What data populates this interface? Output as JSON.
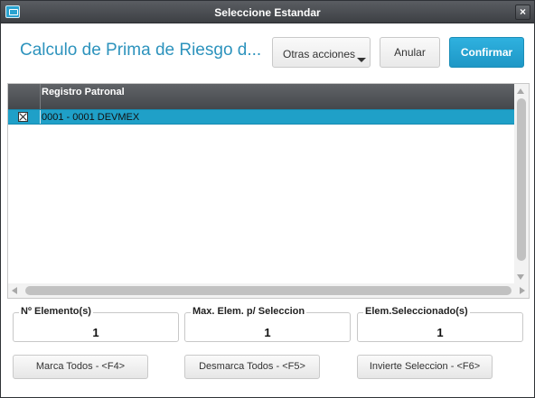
{
  "window": {
    "title": "Seleccione Estandar",
    "close_glyph": "×",
    "app_icon": "window-icon"
  },
  "header": {
    "title": "Calculo de Prima de Riesgo d...",
    "other_actions_label": "Otras acciones",
    "cancel_label": "Anular",
    "confirm_label": "Confirmar"
  },
  "grid": {
    "columns": [
      "Registro Patronal"
    ],
    "rows": [
      {
        "checked": true,
        "value": "0001 - 0001 DEVMEX"
      }
    ]
  },
  "stats": {
    "elements": {
      "label": "Nº Elemento(s)",
      "value": "1"
    },
    "max_select": {
      "label": "Max. Elem. p/ Seleccion",
      "value": "1"
    },
    "selected": {
      "label": "Elem.Seleccionado(s)",
      "value": "1"
    }
  },
  "footer": {
    "mark_all": "Marca Todos - <F4>",
    "unmark_all": "Desmarca Todos - <F5>",
    "invert": "Invierte Seleccion - <F6>"
  },
  "colors": {
    "accent": "#2d93bd",
    "primary_button": "#1e97c6",
    "selected_row": "#1fa0c8",
    "titlebar": "#45484c"
  }
}
